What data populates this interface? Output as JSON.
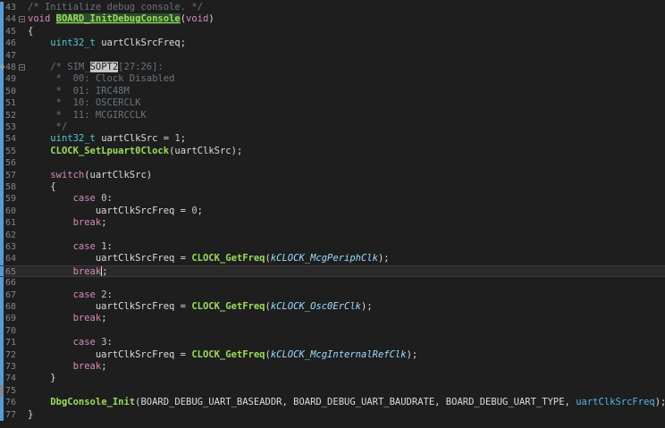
{
  "editor": {
    "lines": [
      {
        "n": "43",
        "bar": "blue",
        "segs": [
          {
            "t": "cmt",
            "v": "/* Initialize debug console. */"
          }
        ]
      },
      {
        "n": "44",
        "bar": "blue",
        "fold": "−",
        "segs": [
          {
            "t": "kw",
            "v": "void"
          },
          {
            "t": "txt",
            "v": " "
          },
          {
            "t": "fnh",
            "v": "BOARD_InitDebugConsole"
          },
          {
            "t": "txt",
            "v": "("
          },
          {
            "t": "kw",
            "v": "void"
          },
          {
            "t": "txt",
            "v": ")"
          }
        ]
      },
      {
        "n": "45",
        "bar": "blue",
        "segs": [
          {
            "t": "txt",
            "v": "{"
          }
        ]
      },
      {
        "n": "46",
        "bar": "blue",
        "segs": [
          {
            "t": "txt",
            "v": "    "
          },
          {
            "t": "type",
            "v": "uint32_t"
          },
          {
            "t": "txt",
            "v": " uartClkSrcFreq;"
          }
        ]
      },
      {
        "n": "47",
        "bar": "blue",
        "segs": []
      },
      {
        "n": "48",
        "bar": "blue",
        "fold": "−",
        "warn": true,
        "segs": [
          {
            "t": "txt",
            "v": "    "
          },
          {
            "t": "cmt",
            "v": "/* SIM_"
          },
          {
            "t": "cmtkw",
            "v": "SOPT2"
          },
          {
            "t": "cmt",
            "v": "[27:26]:"
          }
        ]
      },
      {
        "n": "49",
        "bar": "blue",
        "segs": [
          {
            "t": "cmt",
            "v": "     *  00: Clock Disabled"
          }
        ]
      },
      {
        "n": "50",
        "bar": "blue",
        "segs": [
          {
            "t": "cmt",
            "v": "     *  01: IRC48M"
          }
        ]
      },
      {
        "n": "51",
        "bar": "blue",
        "segs": [
          {
            "t": "cmt",
            "v": "     *  10: OSCERCLK"
          }
        ]
      },
      {
        "n": "52",
        "bar": "blue",
        "segs": [
          {
            "t": "cmt",
            "v": "     *  11: MCGIRCCLK"
          }
        ]
      },
      {
        "n": "53",
        "bar": "blue",
        "segs": [
          {
            "t": "cmt",
            "v": "     */"
          }
        ]
      },
      {
        "n": "54",
        "bar": "blue",
        "segs": [
          {
            "t": "txt",
            "v": "    "
          },
          {
            "t": "type",
            "v": "uint32_t"
          },
          {
            "t": "txt",
            "v": " uartClkSrc = "
          },
          {
            "t": "num",
            "v": "1"
          },
          {
            "t": "txt",
            "v": ";"
          }
        ]
      },
      {
        "n": "55",
        "bar": "blue",
        "segs": [
          {
            "t": "txt",
            "v": "    "
          },
          {
            "t": "fn",
            "v": "CLOCK_SetLpuart0Clock"
          },
          {
            "t": "txt",
            "v": "(uartClkSrc);"
          }
        ]
      },
      {
        "n": "56",
        "bar": "blue",
        "segs": []
      },
      {
        "n": "57",
        "bar": "blue",
        "segs": [
          {
            "t": "txt",
            "v": "    "
          },
          {
            "t": "kw",
            "v": "switch"
          },
          {
            "t": "txt",
            "v": "(uartClkSrc)"
          }
        ]
      },
      {
        "n": "58",
        "bar": "blue",
        "segs": [
          {
            "t": "txt",
            "v": "    {"
          }
        ]
      },
      {
        "n": "59",
        "bar": "blue",
        "segs": [
          {
            "t": "txt",
            "v": "        "
          },
          {
            "t": "kw",
            "v": "case"
          },
          {
            "t": "txt",
            "v": " "
          },
          {
            "t": "num",
            "v": "0"
          },
          {
            "t": "txt",
            "v": ":"
          }
        ]
      },
      {
        "n": "60",
        "bar": "blue",
        "segs": [
          {
            "t": "txt",
            "v": "            uartClkSrcFreq = "
          },
          {
            "t": "num",
            "v": "0"
          },
          {
            "t": "txt",
            "v": ";"
          }
        ]
      },
      {
        "n": "61",
        "bar": "blue",
        "segs": [
          {
            "t": "txt",
            "v": "        "
          },
          {
            "t": "kw",
            "v": "break"
          },
          {
            "t": "txt",
            "v": ";"
          }
        ]
      },
      {
        "n": "62",
        "bar": "blue",
        "segs": []
      },
      {
        "n": "63",
        "bar": "blue",
        "segs": [
          {
            "t": "txt",
            "v": "        "
          },
          {
            "t": "kw",
            "v": "case"
          },
          {
            "t": "txt",
            "v": " "
          },
          {
            "t": "num",
            "v": "1"
          },
          {
            "t": "txt",
            "v": ":"
          }
        ]
      },
      {
        "n": "64",
        "bar": "blue",
        "segs": [
          {
            "t": "txt",
            "v": "            uartClkSrcFreq = "
          },
          {
            "t": "fn",
            "v": "CLOCK_GetFreq"
          },
          {
            "t": "txt",
            "v": "("
          },
          {
            "t": "par",
            "v": "kCLOCK_McgPeriphClk"
          },
          {
            "t": "txt",
            "v": ");"
          }
        ]
      },
      {
        "n": "65",
        "bar": "blue",
        "current": true,
        "segs": [
          {
            "t": "txt",
            "v": "        "
          },
          {
            "t": "kw",
            "v": "break"
          },
          {
            "t": "cursor",
            "v": ""
          },
          {
            "t": "txt",
            "v": ";"
          }
        ]
      },
      {
        "n": "66",
        "bar": "blue",
        "segs": []
      },
      {
        "n": "67",
        "bar": "blue",
        "segs": [
          {
            "t": "txt",
            "v": "        "
          },
          {
            "t": "kw",
            "v": "case"
          },
          {
            "t": "txt",
            "v": " "
          },
          {
            "t": "num",
            "v": "2"
          },
          {
            "t": "txt",
            "v": ":"
          }
        ]
      },
      {
        "n": "68",
        "bar": "blue",
        "segs": [
          {
            "t": "txt",
            "v": "            uartClkSrcFreq = "
          },
          {
            "t": "fn",
            "v": "CLOCK_GetFreq"
          },
          {
            "t": "txt",
            "v": "("
          },
          {
            "t": "par",
            "v": "kCLOCK_Osc0ErClk"
          },
          {
            "t": "txt",
            "v": ");"
          }
        ]
      },
      {
        "n": "69",
        "bar": "blue",
        "segs": [
          {
            "t": "txt",
            "v": "        "
          },
          {
            "t": "kw",
            "v": "break"
          },
          {
            "t": "txt",
            "v": ";"
          }
        ]
      },
      {
        "n": "70",
        "bar": "blue",
        "segs": []
      },
      {
        "n": "71",
        "bar": "blue",
        "segs": [
          {
            "t": "txt",
            "v": "        "
          },
          {
            "t": "kw",
            "v": "case"
          },
          {
            "t": "txt",
            "v": " "
          },
          {
            "t": "num",
            "v": "3"
          },
          {
            "t": "txt",
            "v": ":"
          }
        ]
      },
      {
        "n": "72",
        "bar": "blue",
        "segs": [
          {
            "t": "txt",
            "v": "            uartClkSrcFreq = "
          },
          {
            "t": "fn",
            "v": "CLOCK_GetFreq"
          },
          {
            "t": "txt",
            "v": "("
          },
          {
            "t": "par",
            "v": "kCLOCK_McgInternalRefClk"
          },
          {
            "t": "txt",
            "v": ");"
          }
        ]
      },
      {
        "n": "73",
        "bar": "blue",
        "segs": [
          {
            "t": "txt",
            "v": "        "
          },
          {
            "t": "kw",
            "v": "break"
          },
          {
            "t": "txt",
            "v": ";"
          }
        ]
      },
      {
        "n": "74",
        "bar": "blue",
        "segs": [
          {
            "t": "txt",
            "v": "    }"
          }
        ]
      },
      {
        "n": "75",
        "bar": "gray",
        "segs": []
      },
      {
        "n": "76",
        "bar": "blue",
        "segs": [
          {
            "t": "txt",
            "v": "    "
          },
          {
            "t": "fn",
            "v": "DbgConsole_Init"
          },
          {
            "t": "txt",
            "v": "(BOARD_DEBUG_UART_BASEADDR, BOARD_DEBUG_UART_BAUDRATE, BOARD_DEBUG_UART_TYPE, "
          },
          {
            "t": "ptype",
            "v": "uartClkSrcFreq"
          },
          {
            "t": "txt",
            "v": ");"
          }
        ]
      },
      {
        "n": "77",
        "bar": "blue",
        "segs": [
          {
            "t": "txt",
            "v": "}"
          }
        ]
      }
    ]
  }
}
